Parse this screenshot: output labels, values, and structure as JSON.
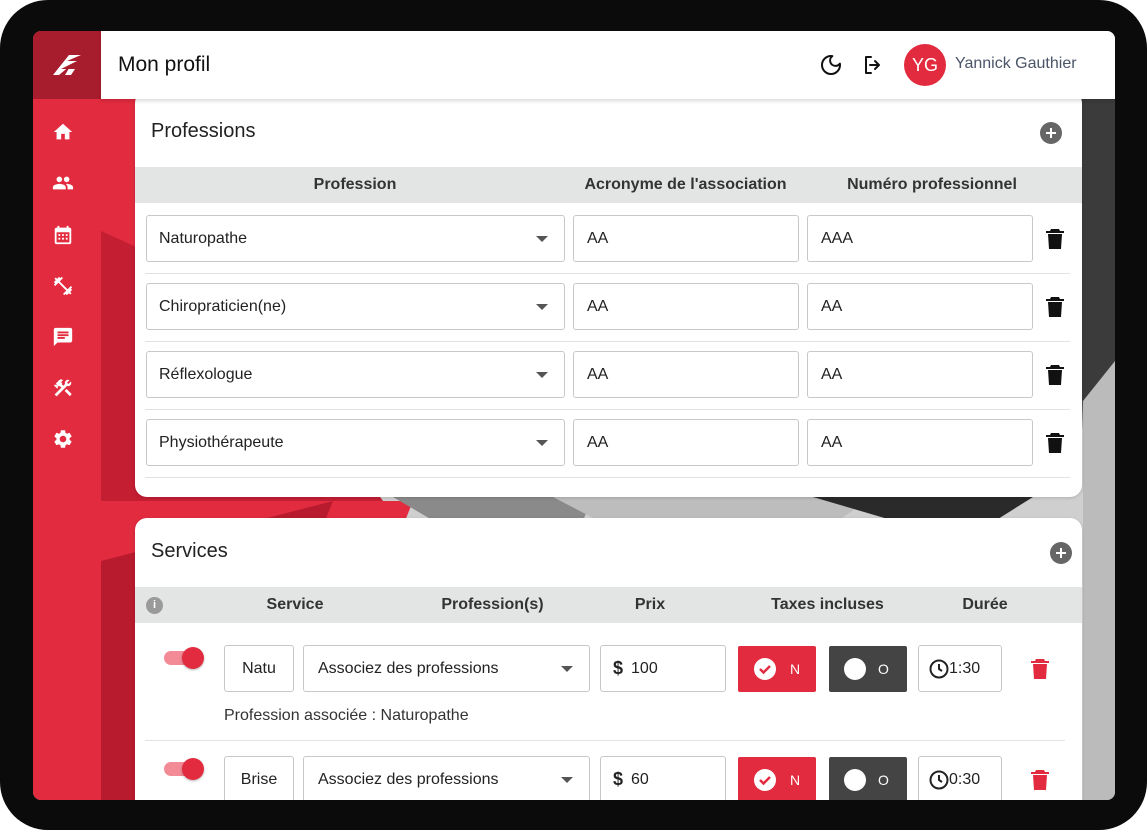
{
  "header": {
    "title": "Mon profil",
    "user_initials": "YG",
    "user_name": "Yannick Gauthier"
  },
  "sidebar": {
    "items": [
      {
        "icon": "home-icon"
      },
      {
        "icon": "users-icon"
      },
      {
        "icon": "calendar-icon"
      },
      {
        "icon": "fitness-icon"
      },
      {
        "icon": "chat-icon"
      },
      {
        "icon": "tools-icon"
      },
      {
        "icon": "gear-icon"
      }
    ]
  },
  "professions": {
    "title": "Professions",
    "columns": [
      "Profession",
      "Acronyme de l'association",
      "Numéro professionnel"
    ],
    "rows": [
      {
        "profession": "Naturopathe",
        "acronyme": "AA",
        "numero": "AAA"
      },
      {
        "profession": "Chiropraticien(ne)",
        "acronyme": "AA",
        "numero": "AA"
      },
      {
        "profession": "Réflexologue",
        "acronyme": "AA",
        "numero": "AA"
      },
      {
        "profession": "Physiothérapeute",
        "acronyme": "AA",
        "numero": "AA"
      }
    ]
  },
  "services": {
    "title": "Services",
    "columns": [
      "Service",
      "Profession(s)",
      "Prix",
      "Taxes incluses",
      "Durée"
    ],
    "rows": [
      {
        "name": "Natu",
        "professions_placeholder": "Associez des professions",
        "currency": "$",
        "price": "100",
        "tax_yes": "N",
        "tax_no": "O",
        "duration": "1:30",
        "associated": "Profession associée : Naturopathe"
      },
      {
        "name": "Brise",
        "professions_placeholder": "Associez des professions",
        "currency": "$",
        "price": "60",
        "tax_yes": "N",
        "tax_no": "O",
        "duration": "0:30"
      }
    ]
  },
  "colors": {
    "accent": "#e32b3f",
    "accent_dark": "#a81d2e",
    "dark_button": "#444444"
  }
}
